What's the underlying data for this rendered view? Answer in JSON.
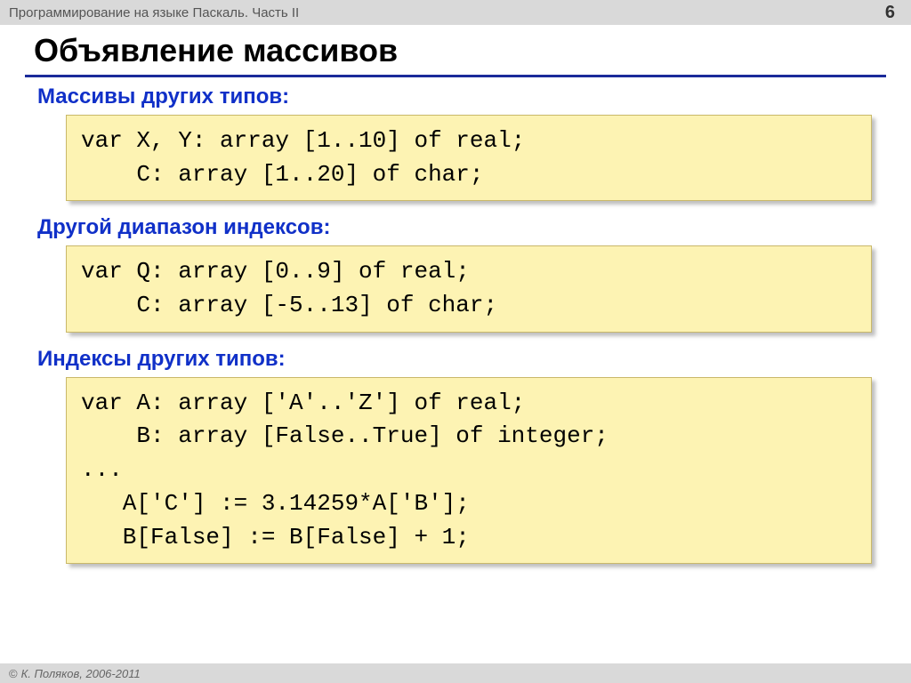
{
  "header": {
    "title": "Программирование на языке Паскаль. Часть II",
    "page_number": "6"
  },
  "slide_title": "Объявление массивов",
  "sections": [
    {
      "label": "Массивы других типов:",
      "code": "var X, Y: array [1..10] of real;\n    C: array [1..20] of char;"
    },
    {
      "label": "Другой диапазон индексов:",
      "code": "var Q: array [0..9] of real;\n    C: array [-5..13] of char;"
    },
    {
      "label": "Индексы других типов:",
      "code": "var A: array ['A'..'Z'] of real;\n    B: array [False..True] of integer;\n...\n   A['C'] := 3.14259*A['B'];\n   B[False] := B[False] + 1;"
    }
  ],
  "footer": {
    "copyright_symbol": "©",
    "text": "К. Поляков, 2006-2011"
  }
}
